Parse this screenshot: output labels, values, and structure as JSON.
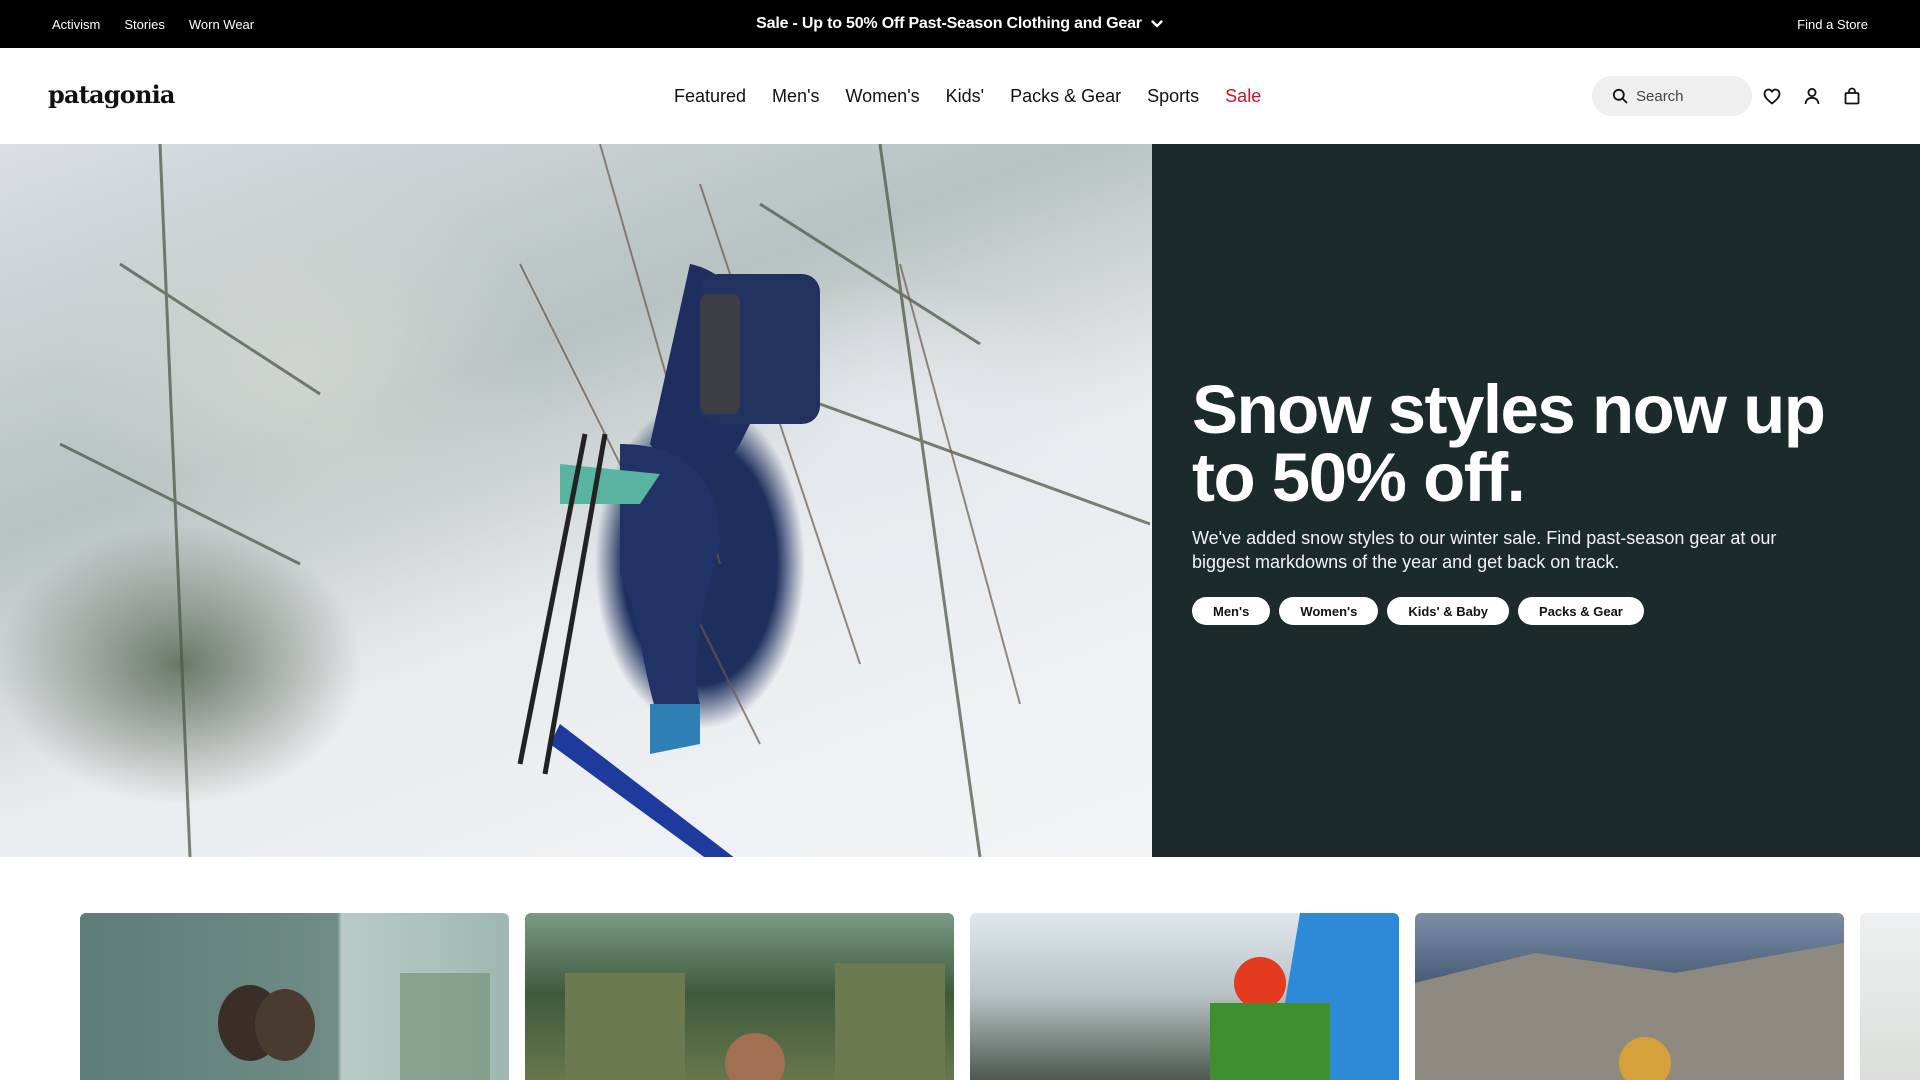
{
  "utility_bar": {
    "links": [
      "Activism",
      "Stories",
      "Worn Wear"
    ],
    "promo": "Sale - Up to 50% Off Past-Season Clothing and Gear",
    "store_link": "Find a Store"
  },
  "header": {
    "logo": "patagonia",
    "nav": [
      "Featured",
      "Men's",
      "Women's",
      "Kids'",
      "Packs & Gear",
      "Sports",
      "Sale"
    ],
    "search_placeholder": "Search",
    "icons": [
      "heart-icon",
      "account-icon",
      "bag-icon"
    ]
  },
  "hero": {
    "title": "Snow styles now up to 50% off.",
    "subtitle": "We've added snow styles to our winter sale. Find past-season gear at our biggest markdowns of the year and get back on track.",
    "buttons": [
      "Men's",
      "Women's",
      "Kids' & Baby",
      "Packs & Gear"
    ],
    "panel_color": "#1b2a2b",
    "sale_color": "#c8102e"
  }
}
